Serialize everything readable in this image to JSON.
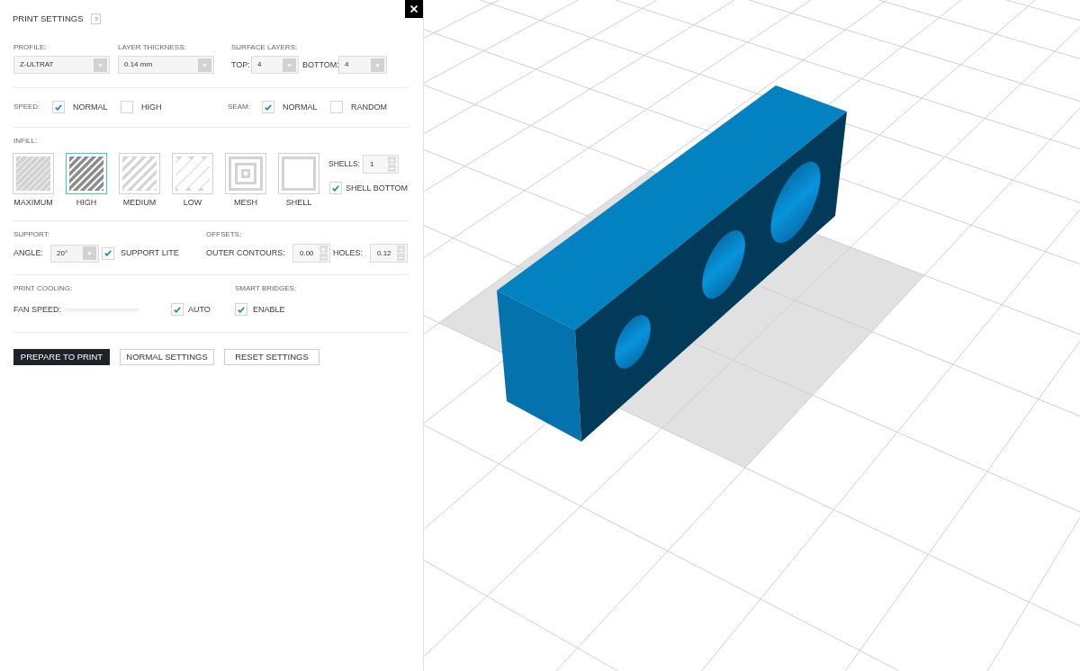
{
  "panel": {
    "title": "PRINT SETTINGS",
    "help": "?"
  },
  "profile": {
    "label": "PROFILE:",
    "value": "Z-ULTRAT"
  },
  "layer_thickness": {
    "label": "LAYER THICKNESS:",
    "value": "0.14 mm"
  },
  "surface_layers": {
    "label": "SURFACE LAYERS:",
    "fields": [
      {
        "label": "TOP:",
        "value": "4"
      },
      {
        "label": "BOTTOM:",
        "value": "4"
      }
    ]
  },
  "speed": {
    "label": "SPEED:",
    "options": [
      {
        "label": "NORMAL",
        "checked": true
      },
      {
        "label": "HIGH",
        "checked": false
      }
    ]
  },
  "seam": {
    "label": "SEAM:",
    "options": [
      {
        "label": "NORMAL",
        "checked": true
      },
      {
        "label": "RANDOM",
        "checked": false
      }
    ]
  },
  "infill": {
    "label": "INFILL:",
    "options": [
      {
        "label": "MAXIMUM",
        "kind": "fine",
        "selected": false
      },
      {
        "label": "HIGH",
        "kind": "dense",
        "selected": true
      },
      {
        "label": "MEDIUM",
        "kind": "medium",
        "selected": false
      },
      {
        "label": "LOW",
        "kind": "wide",
        "selected": false
      },
      {
        "label": "MESH",
        "kind": "rings",
        "selected": false
      },
      {
        "label": "SHELL",
        "kind": "frame",
        "selected": false
      }
    ],
    "shells": {
      "label": "SHELLS:",
      "value": "1"
    },
    "shell_bottom": {
      "label": "SHELL BOTTOM",
      "checked": true
    }
  },
  "support": {
    "label": "SUPPORT:",
    "angle": {
      "label": "ANGLE:",
      "value": "20°"
    },
    "support_lite": {
      "label": "SUPPORT LITE",
      "checked": true
    }
  },
  "offsets": {
    "label": "OFFSETS:",
    "fields": [
      {
        "label": "OUTER CONTOURS:",
        "value": "0.00"
      },
      {
        "label": "HOLES:",
        "value": "0.12"
      }
    ]
  },
  "print_cooling": {
    "label": "PRINT COOLING:",
    "fan_speed": {
      "label": "FAN SPEED:",
      "disabled": true
    },
    "auto": {
      "label": "AUTO",
      "checked": true
    }
  },
  "smart_bridges": {
    "label": "SMART BRIDGES:",
    "enable": {
      "label": "ENABLE",
      "checked": true
    }
  },
  "buttons": [
    {
      "label": "PREPARE TO PRINT",
      "kind": "primary"
    },
    {
      "label": "NORMAL SETTINGS",
      "kind": "secondary"
    },
    {
      "label": "RESET SETTINGS",
      "kind": "secondary"
    }
  ]
}
